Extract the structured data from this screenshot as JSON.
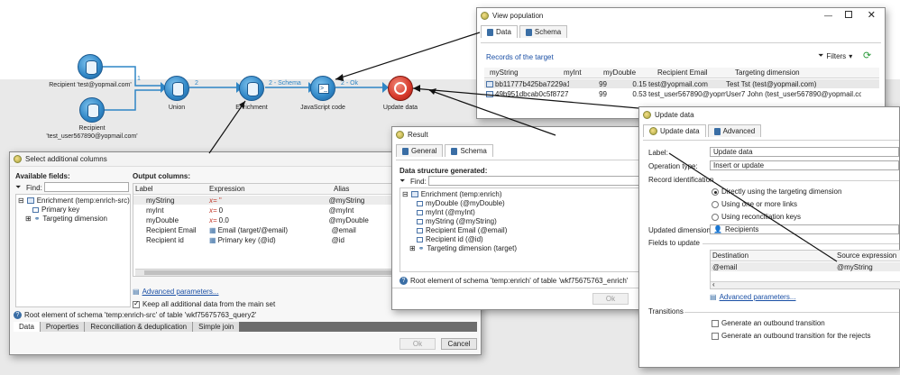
{
  "workflow": {
    "nodes": {
      "recipient1": "Recipient 'test@yopmail.com'",
      "recipient2_line1": "Recipient",
      "recipient2_line2": "'test_user567890@yopmail.com'",
      "union": "Union",
      "enrichment": "Enrichment",
      "js": "JavaScript code",
      "update": "Update data"
    },
    "links": {
      "l1": "1",
      "l2": "2",
      "schema": "2 - Schema",
      "ok": "2 - Ok"
    }
  },
  "view_population": {
    "title": "View population",
    "tabs": [
      "Data",
      "Schema"
    ],
    "subtitle": "Records of the target",
    "filters": "Filters",
    "columns": [
      "myString",
      "myInt",
      "myDouble",
      "Recipient Email",
      "Targeting dimension"
    ],
    "rows": [
      [
        "bb11777b425ba7229a1...",
        "99",
        "0.15",
        "test@yopmail.com",
        "Test Tst (test@yopmail.com)"
      ],
      [
        "49b951dbcab0c5f8727...",
        "99",
        "0.53",
        "test_user567890@yopmai...",
        "User7 John (test_user567890@yopmail.com)"
      ]
    ]
  },
  "select_columns": {
    "title": "Select additional columns",
    "available_fields_label": "Available fields:",
    "output_columns_label": "Output columns:",
    "find_label": "Find:",
    "tree": [
      "Enrichment (temp:enrich-src)",
      "Primary key",
      "Targeting dimension"
    ],
    "col_headers": [
      "Label",
      "Expression",
      "Alias"
    ],
    "rows": [
      [
        "myString",
        "''",
        "@myString"
      ],
      [
        "myInt",
        "0",
        "@myInt"
      ],
      [
        "myDouble",
        "0.0",
        "@myDouble"
      ],
      [
        "Recipient Email",
        "Email (target/@email)",
        "@email"
      ],
      [
        "Recipient id",
        "Primary key (@id)",
        "@id"
      ]
    ],
    "advanced": "Advanced parameters...",
    "keep": "Keep all additional data from the main set",
    "root": "Root element of schema 'temp:enrich-src' of table 'wkf75675763_query2'",
    "bottom_tabs": [
      "Data",
      "Properties",
      "Reconciliation & deduplication",
      "Simple join"
    ],
    "ok": "Ok",
    "cancel": "Cancel"
  },
  "result": {
    "title": "Result",
    "tabs": [
      "General",
      "Schema"
    ],
    "structure_label": "Data structure generated:",
    "find_label": "Find:",
    "tree": [
      "Enrichment (temp:enrich)",
      "myDouble (@myDouble)",
      "myInt (@myInt)",
      "myString (@myString)",
      "Recipient Email (@email)",
      "Recipient id (@id)",
      "Targeting dimension (target)"
    ],
    "root": "Root element of schema 'temp:enrich' of table 'wkf75675763_enrich'",
    "ok": "Ok"
  },
  "update_data": {
    "title": "Update data",
    "tabs": [
      "Update data",
      "Advanced"
    ],
    "label_label": "Label:",
    "label_value": "Update data",
    "op_label": "Operation type:",
    "op_value": "Insert or update",
    "record_id": "Record identification",
    "radios": [
      "Directly using the targeting dimension",
      "Using one or more links",
      "Using reconciliation keys"
    ],
    "dim_label": "Updated dimension:",
    "dim_value": "Recipients",
    "fields_label": "Fields to update",
    "dest_header": "Destination",
    "src_header": "Source expression",
    "dest_value": "@email",
    "src_value": "@myString",
    "advanced": "Advanced parameters...",
    "transitions": "Transitions",
    "checks": [
      "Generate an outbound transition",
      "Generate an outbound transition for the rejects"
    ]
  },
  "colors": {
    "node_blue": "#2f86c6",
    "link": "#1a4fa5",
    "expr_red": "#c0392b"
  }
}
